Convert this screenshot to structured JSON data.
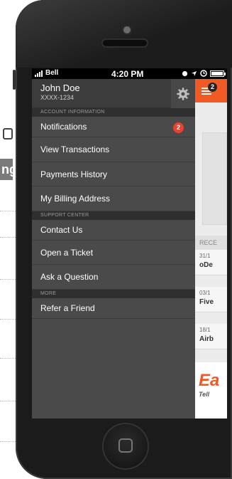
{
  "status_bar": {
    "carrier": "Bell",
    "time": "4:20 PM"
  },
  "user": {
    "name": "John Doe",
    "account": "XXXX-1234"
  },
  "sections": [
    {
      "header": "ACCOUNT INFORMATION",
      "items": [
        {
          "label": "Notifications",
          "badge": "2"
        },
        {
          "label": "View Transactions"
        },
        {
          "label": "Payments History"
        },
        {
          "label": "My Billing Address"
        }
      ]
    },
    {
      "header": "SUPPORT CENTER",
      "items": [
        {
          "label": "Contact Us"
        },
        {
          "label": "Open a Ticket"
        },
        {
          "label": "Ask a Question"
        }
      ]
    },
    {
      "header": "MORE",
      "items": [
        {
          "label": "Refer a Friend"
        }
      ]
    }
  ],
  "peek": {
    "menu_badge": "2",
    "recent_label": "RECE",
    "rows": [
      {
        "date": "31/1",
        "title": "oDe"
      },
      {
        "date": "03/1",
        "title": "Five"
      },
      {
        "date": "18/1",
        "title": "Airb"
      }
    ],
    "banner_brand": "Ea",
    "banner_tagline": "Tell"
  },
  "background_fragment": "ng",
  "colors": {
    "accent": "#f15a24",
    "badge": "#e8442d",
    "menu_bg": "#4a4a4a",
    "section_bg": "#2f2f2f"
  }
}
